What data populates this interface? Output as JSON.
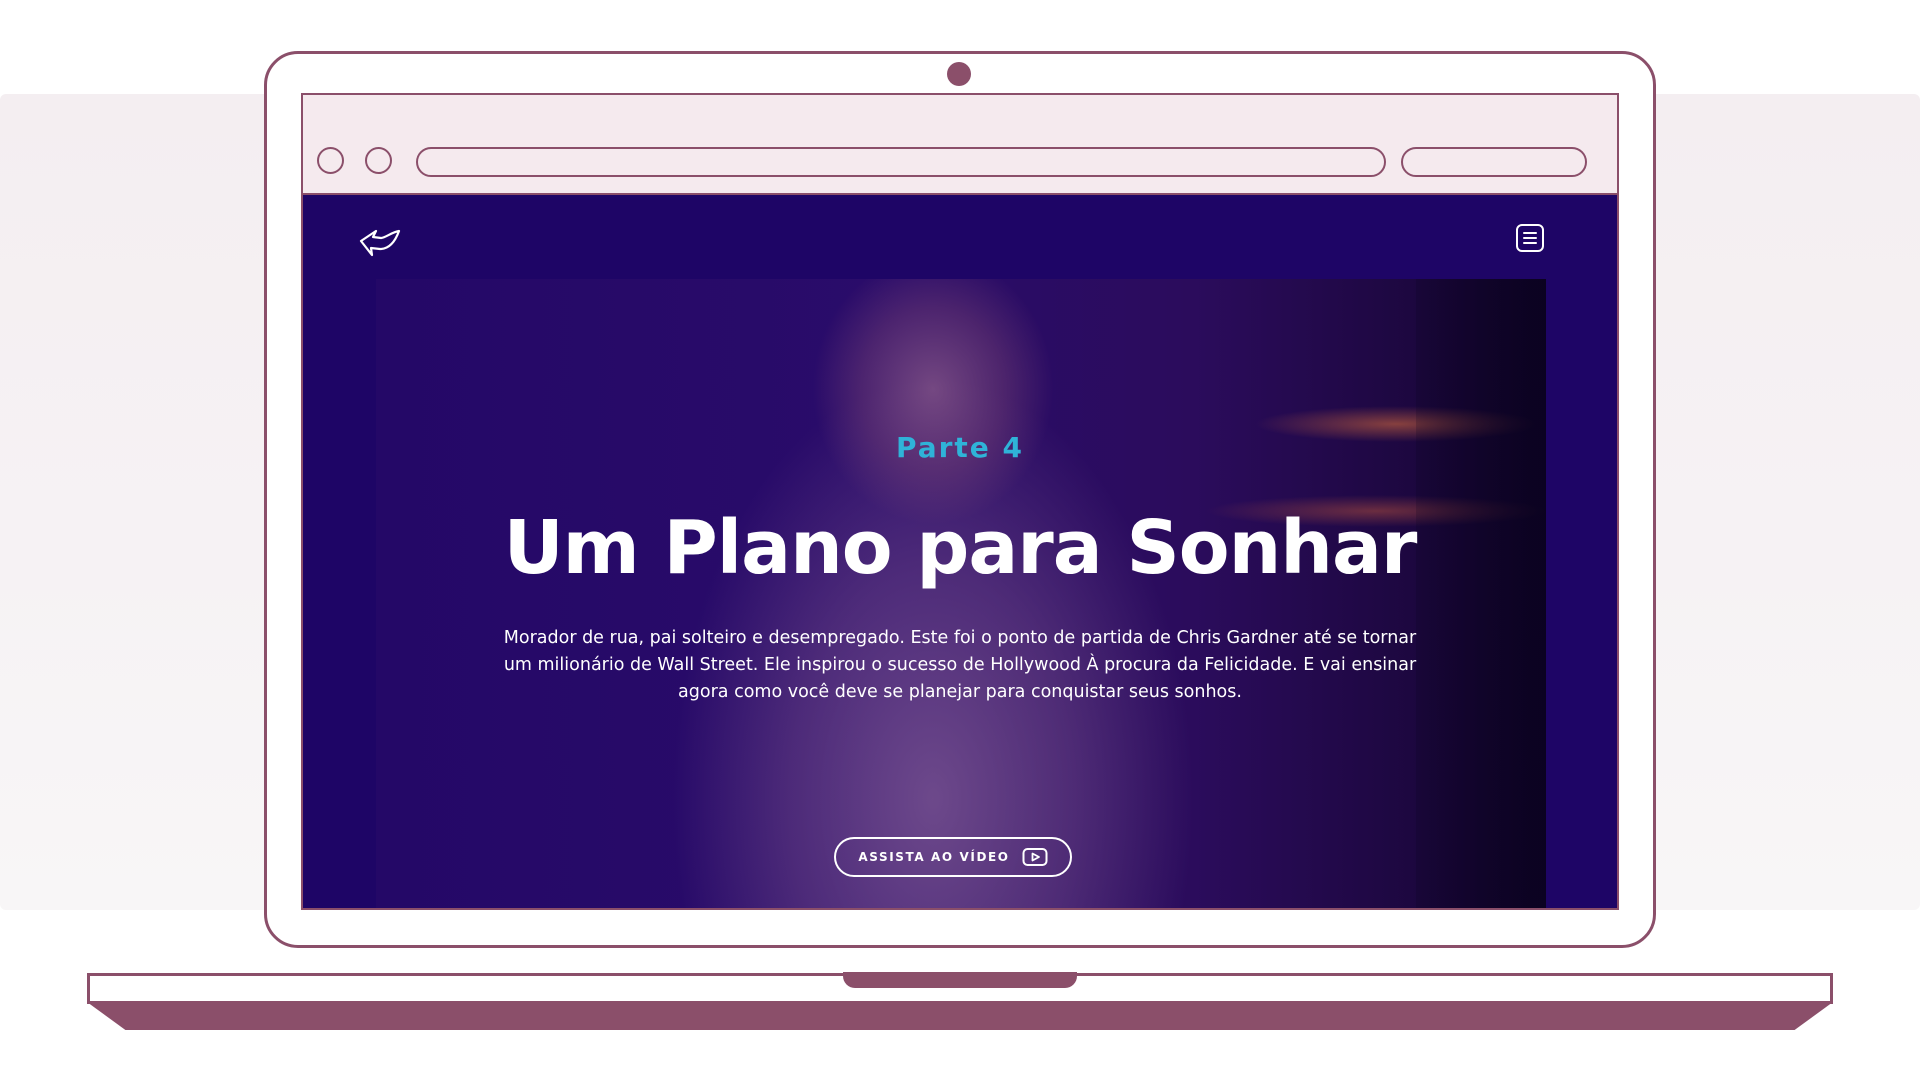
{
  "hero": {
    "part_label": "Parte 4",
    "title": "Um Plano para Sonhar",
    "description": "Morador de rua, pai solteiro e desempregado. Este foi o ponto de partida de Chris Gardner até se tornar um milionário de Wall Street. Ele inspirou o sucesso de Hollywood À procura da Felicidade. E vai ensinar agora como você deve se planejar para conquistar seus sonhos.",
    "cta_label": "ASSISTA AO VÍDEO"
  },
  "icons": {
    "back": "back-arrow-icon",
    "menu": "menu-icon",
    "play": "play-video-icon"
  },
  "colors": {
    "frame": "#8b4f6a",
    "site_background": "#1e0566",
    "accent": "#2fb3d8",
    "browser_bar": "#f5eaee",
    "text": "#ffffff"
  }
}
